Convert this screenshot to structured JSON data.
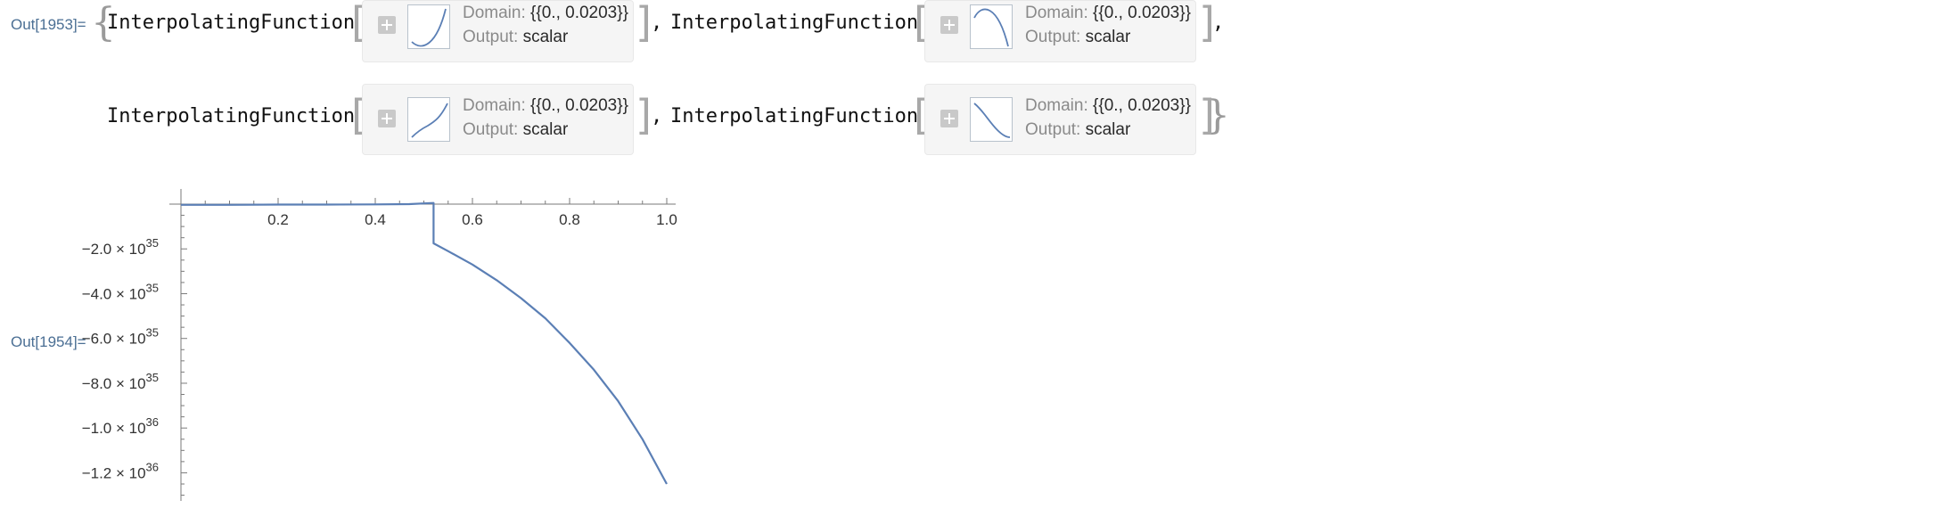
{
  "outputs": [
    {
      "label": "Out[1953]="
    },
    {
      "label": "Out[1954]="
    }
  ],
  "list": {
    "open_brace": "{",
    "close_brace": "}"
  },
  "functions": [
    {
      "name": "InterpolatingFunction",
      "domain_key": "Domain:",
      "domain_val": "{{0., 0.0203}}",
      "output_key": "Output:",
      "output_val": "scalar",
      "thumb": "convex-up-icon"
    },
    {
      "name": "InterpolatingFunction",
      "domain_key": "Domain:",
      "domain_val": "{{0., 0.0203}}",
      "output_key": "Output:",
      "output_val": "scalar",
      "thumb": "arch-icon"
    },
    {
      "name": "InterpolatingFunction",
      "domain_key": "Domain:",
      "domain_val": "{{0., 0.0203}}",
      "output_key": "Output:",
      "output_val": "scalar",
      "thumb": "rising-concave-icon"
    },
    {
      "name": "InterpolatingFunction",
      "domain_key": "Domain:",
      "domain_val": "{{0., 0.0203}}",
      "output_key": "Output:",
      "output_val": "scalar",
      "thumb": "falling-icon"
    }
  ],
  "colors": {
    "label": "#4b6f94",
    "curve": "#5b7fb5",
    "axis": "#7a7a7a"
  },
  "chart_data": {
    "type": "line",
    "title": "",
    "xlabel": "",
    "ylabel": "",
    "xlim": [
      0,
      1.0
    ],
    "ylim": [
      -1.3e+36,
      4e+34
    ],
    "x_ticks": [
      "0.2",
      "0.4",
      "0.6",
      "0.8",
      "1.0"
    ],
    "x_tick_values": [
      0.2,
      0.4,
      0.6,
      0.8,
      1.0
    ],
    "y_ticks": [
      {
        "value": -2e+35,
        "mantissa": "−2.0 × 10",
        "exp": "35"
      },
      {
        "value": -4e+35,
        "mantissa": "−4.0 × 10",
        "exp": "35"
      },
      {
        "value": -6e+35,
        "mantissa": "−6.0 × 10",
        "exp": "35"
      },
      {
        "value": -8e+35,
        "mantissa": "−8.0 × 10",
        "exp": "35"
      },
      {
        "value": -1e+36,
        "mantissa": "−1.0 × 10",
        "exp": "36"
      },
      {
        "value": -1.2e+36,
        "mantissa": "−1.2 × 10",
        "exp": "36"
      }
    ],
    "series": [
      {
        "x": [
          0.0,
          0.1,
          0.2,
          0.3,
          0.4,
          0.47,
          0.52,
          0.52,
          0.55,
          0.6,
          0.65,
          0.7,
          0.75,
          0.8,
          0.85,
          0.9,
          0.95,
          1.0
        ],
        "y": [
          -3e+33,
          -3e+33,
          -2e+33,
          -2e+33,
          -1e+33,
          0.0,
          5e+33,
          -1.75e+35,
          -2.1e+35,
          -2.7e+35,
          -3.4e+35,
          -4.2e+35,
          -5.1e+35,
          -6.2e+35,
          -7.4e+35,
          -8.8e+35,
          -1.05e+36,
          -1.25e+36
        ]
      }
    ],
    "grid": false
  }
}
